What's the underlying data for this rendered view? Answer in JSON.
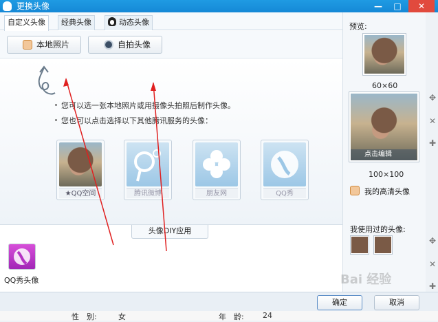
{
  "window": {
    "title": "更换头像",
    "min_glyph": "—",
    "max_glyph": "□",
    "close_glyph": "✕"
  },
  "tabs": [
    {
      "label": "自定义头像"
    },
    {
      "label": "经典头像"
    },
    {
      "label": "动态头像"
    }
  ],
  "toolbar": {
    "local_photo_label": "本地照片",
    "selfie_label": "自拍头像"
  },
  "tips": [
    "您可以选一张本地照片或用摄像头拍照后制作头像。",
    "您也可以点击选择以下其他腾讯服务的头像："
  ],
  "services": [
    {
      "label": "QQ空间"
    },
    {
      "label": "腾讯微博"
    },
    {
      "label": "朋友网"
    },
    {
      "label": "QQ秀"
    }
  ],
  "diy_apps_label": "头像DIY应用",
  "app": {
    "label": "QQ秀头像"
  },
  "preview": {
    "title": "预览:",
    "small_size": "60×60",
    "edit_label": "点击编辑",
    "large_size": "100×100",
    "hd_label": "我的高清头像",
    "used_title": "我使用过的头像:"
  },
  "strip_icons": [
    "move-icon",
    "close-icon",
    "plus-icon",
    "move-icon",
    "close-icon",
    "plus-icon"
  ],
  "buttons": {
    "ok": "确定",
    "cancel": "取消"
  },
  "behind": {
    "gender_label": "性　别:",
    "gender_value": "女",
    "age_label": "年　龄:",
    "age_value": "24"
  },
  "watermark": "Bai 经验",
  "colors": {
    "titlebar": "#1f9be3",
    "annotation_arrow": "#e02020"
  }
}
